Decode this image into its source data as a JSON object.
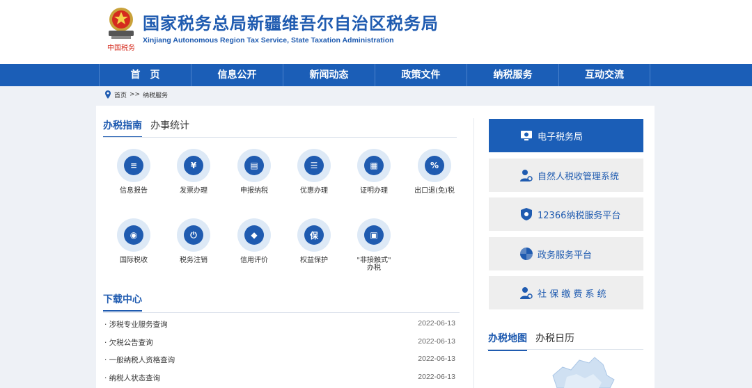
{
  "header": {
    "title": "国家税务总局新疆维吾尔自治区税务局",
    "subtitle": "Xinjiang Autonomous Region Tax Service, State Taxation Administration",
    "logo_text": "中国税务"
  },
  "nav": [
    "首　页",
    "信息公开",
    "新闻动态",
    "政策文件",
    "纳税服务",
    "互动交流"
  ],
  "breadcrumb": {
    "home": "首页",
    "sep": ">>",
    "current": "纳税服务"
  },
  "guide_tabs": [
    "办税指南",
    "办事统计"
  ],
  "services": [
    {
      "label": "信息报告",
      "icon": "document-icon",
      "glyph": "≡"
    },
    {
      "label": "发票办理",
      "icon": "invoice-icon",
      "glyph": "¥"
    },
    {
      "label": "申报纳税",
      "icon": "declare-icon",
      "glyph": "▤"
    },
    {
      "label": "优惠办理",
      "icon": "discount-icon",
      "glyph": "☰"
    },
    {
      "label": "证明办理",
      "icon": "certificate-icon",
      "glyph": "▦"
    },
    {
      "label": "出口退(免)税",
      "icon": "percent-icon",
      "glyph": "%"
    },
    {
      "label": "国际税收",
      "icon": "globe-icon",
      "glyph": "◉"
    },
    {
      "label": "税务注销",
      "icon": "power-icon",
      "glyph": "⏻"
    },
    {
      "label": "信用评价",
      "icon": "diamond-icon",
      "glyph": "◆"
    },
    {
      "label": "权益保护",
      "icon": "shield-icon",
      "glyph": "保"
    },
    {
      "label": "\"非接触式\"\n办税",
      "icon": "computer-icon",
      "glyph": "▣"
    }
  ],
  "download": {
    "title": "下载中心",
    "items": [
      {
        "title": "涉税专业服务查询",
        "date": "2022-06-13"
      },
      {
        "title": "欠税公告查询",
        "date": "2022-06-13"
      },
      {
        "title": "一般纳税人资格查询",
        "date": "2022-06-13"
      },
      {
        "title": "纳税人状态查询",
        "date": "2022-06-13"
      }
    ]
  },
  "systems": [
    {
      "label": "电子税务局",
      "icon": "monitor-icon"
    },
    {
      "label": "自然人税收管理系统",
      "icon": "person-icon"
    },
    {
      "label": "12366纳税服务平台",
      "icon": "shield-icon"
    },
    {
      "label": "政务服务平台",
      "icon": "pinwheel-icon"
    },
    {
      "label": "社 保 缴 费 系 统",
      "icon": "person-icon"
    }
  ],
  "map_tabs": [
    "办税地图",
    "办税日历"
  ],
  "colors": {
    "brand": "#1f5bb0",
    "nav": "#1b5eb7",
    "background": "#eef1f6"
  }
}
